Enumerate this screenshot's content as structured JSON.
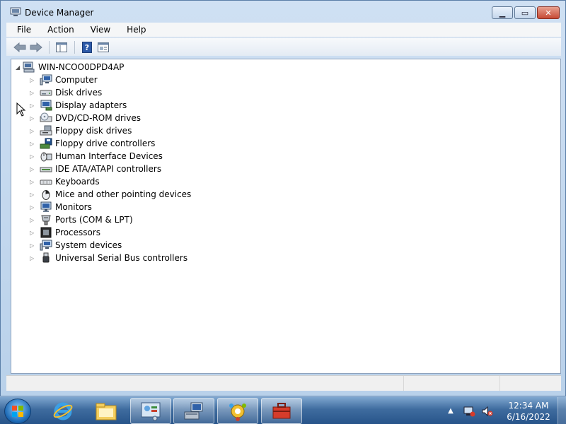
{
  "window": {
    "title": "Device Manager",
    "controls": {
      "minimize": "▁",
      "maximize": "▭",
      "close": "✕"
    }
  },
  "menu": [
    "File",
    "Action",
    "View",
    "Help"
  ],
  "toolbar": [
    "back-arrow-icon",
    "forward-arrow-icon",
    "show-hide-console-tree-icon",
    "help-icon",
    "properties-icon"
  ],
  "tree": {
    "root": "WIN-NCOO0DPD4AP",
    "items": [
      {
        "label": "Computer",
        "icon": "computer-icon"
      },
      {
        "label": "Disk drives",
        "icon": "disk-drive-icon"
      },
      {
        "label": "Display adapters",
        "icon": "display-adapter-icon"
      },
      {
        "label": "DVD/CD-ROM drives",
        "icon": "dvd-drive-icon"
      },
      {
        "label": "Floppy disk drives",
        "icon": "floppy-drive-icon"
      },
      {
        "label": "Floppy drive controllers",
        "icon": "floppy-controller-icon"
      },
      {
        "label": "Human Interface Devices",
        "icon": "hid-icon"
      },
      {
        "label": "IDE ATA/ATAPI controllers",
        "icon": "ide-controller-icon"
      },
      {
        "label": "Keyboards",
        "icon": "keyboard-icon"
      },
      {
        "label": "Mice and other pointing devices",
        "icon": "mouse-icon"
      },
      {
        "label": "Monitors",
        "icon": "monitor-icon"
      },
      {
        "label": "Ports (COM & LPT)",
        "icon": "port-icon"
      },
      {
        "label": "Processors",
        "icon": "processor-icon"
      },
      {
        "label": "System devices",
        "icon": "system-device-icon"
      },
      {
        "label": "Universal Serial Bus controllers",
        "icon": "usb-icon"
      }
    ]
  },
  "taskbar": {
    "buttons": [
      "internet-explorer-icon",
      "windows-explorer-icon",
      "control-panel-icon",
      "network-icon",
      "media-center-icon",
      "toolbox-icon"
    ],
    "clock": {
      "time": "12:34 AM",
      "date": "6/16/2022"
    }
  },
  "colors": {
    "accent": "#2a5d94",
    "title_bar": "#bed3ec",
    "close": "#c74a35"
  }
}
